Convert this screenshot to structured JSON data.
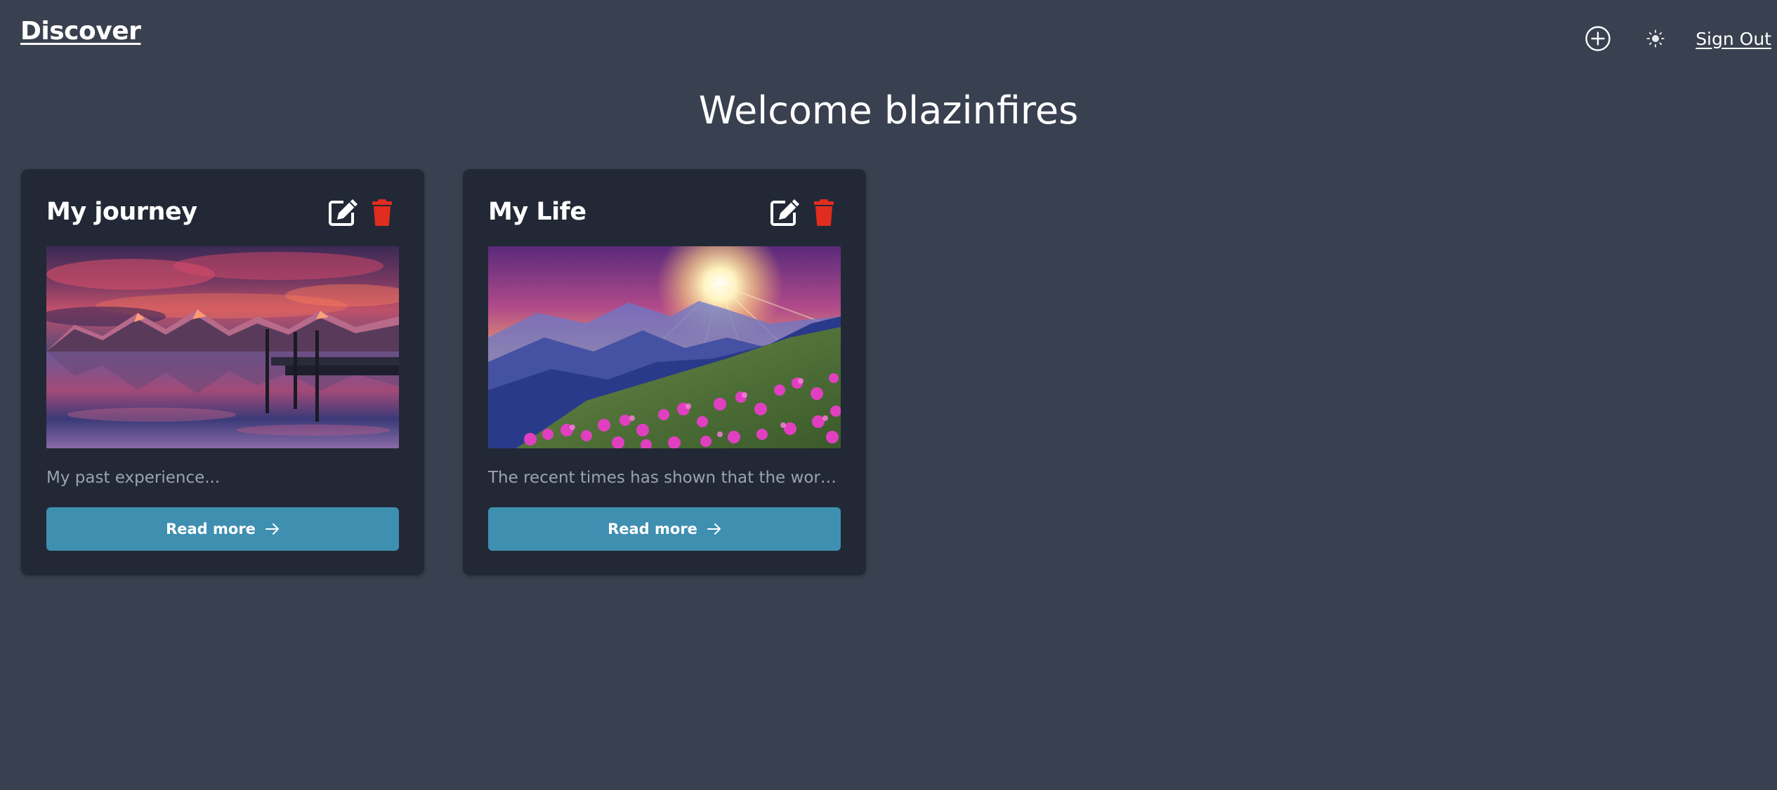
{
  "nav": {
    "brand": "Discover",
    "add_icon": "plus-circle-icon",
    "theme_icon": "sun-icon",
    "signout_label": "Sign Out"
  },
  "welcome": {
    "text": "Welcome blazinfires"
  },
  "colors": {
    "background": "#394150",
    "card": "#222836",
    "button": "#3f8fb1",
    "delete": "#e02d1f",
    "muted_text": "#9ca3af"
  },
  "cards": [
    {
      "title": "My journey",
      "image": "mountain-lake-sunset-with-pier",
      "description": "My past experience...",
      "button_label": "Read more",
      "edit_icon": "edit-icon",
      "delete_icon": "trash-icon"
    },
    {
      "title": "My Life",
      "image": "sunrise-over-mountains-with-pink-flowers",
      "description": "The recent times has shown that the world has...",
      "button_label": "Read more",
      "edit_icon": "edit-icon",
      "delete_icon": "trash-icon"
    }
  ]
}
